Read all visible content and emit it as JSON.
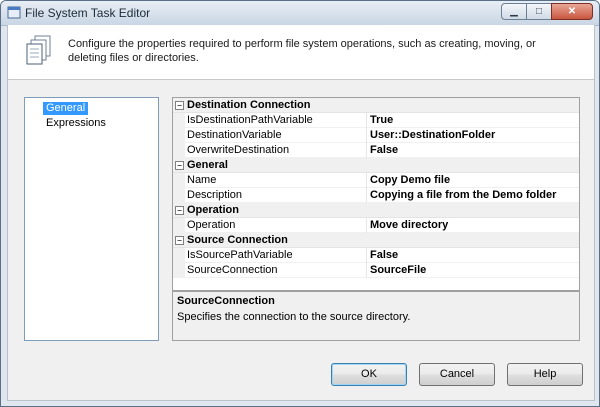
{
  "window": {
    "title": "File System Task Editor"
  },
  "header": {
    "description": "Configure the properties required to perform file system operations, such as creating, moving, or deleting files or directories."
  },
  "nav": {
    "items": [
      "General",
      "Expressions"
    ],
    "selected": 0
  },
  "properties": {
    "categories": [
      {
        "name": "Destination Connection",
        "items": [
          {
            "name": "IsDestinationPathVariable",
            "value": "True"
          },
          {
            "name": "DestinationVariable",
            "value": "User::DestinationFolder"
          },
          {
            "name": "OverwriteDestination",
            "value": "False"
          }
        ]
      },
      {
        "name": "General",
        "items": [
          {
            "name": "Name",
            "value": "Copy Demo file"
          },
          {
            "name": "Description",
            "value": "Copying a file from the Demo folder"
          }
        ]
      },
      {
        "name": "Operation",
        "items": [
          {
            "name": "Operation",
            "value": "Move directory"
          }
        ]
      },
      {
        "name": "Source Connection",
        "items": [
          {
            "name": "IsSourcePathVariable",
            "value": "False"
          },
          {
            "name": "SourceConnection",
            "value": "SourceFile"
          }
        ]
      }
    ],
    "collapse_glyph": "⊟"
  },
  "description_panel": {
    "title": "SourceConnection",
    "text": "Specifies the connection to the source directory."
  },
  "buttons": {
    "ok": "OK",
    "cancel": "Cancel",
    "help": "Help"
  },
  "icons": {
    "minimize": "minimize-icon",
    "maximize": "maximize-icon",
    "close": "close-icon",
    "task": "file-system-task-icon"
  }
}
